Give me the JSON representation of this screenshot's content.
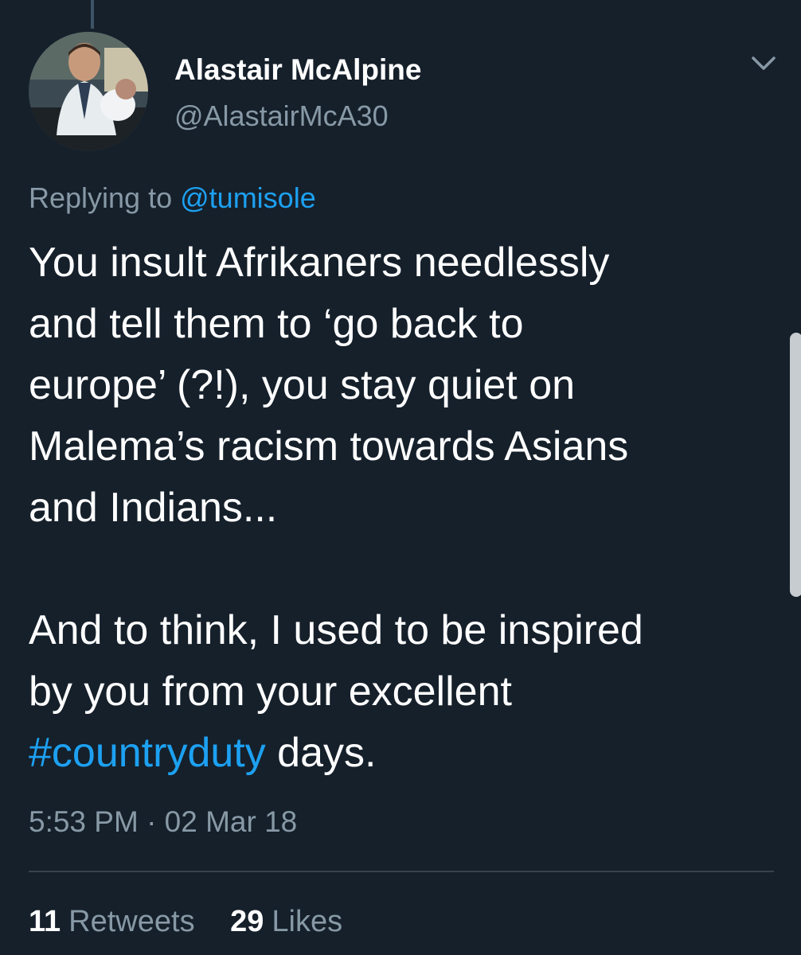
{
  "tweet": {
    "author": {
      "display_name": "Alastair McAlpine",
      "handle": "@AlastairMcA30"
    },
    "reply": {
      "prefix": "Replying to",
      "mention": "@tumisole"
    },
    "text_lines": [
      "You insult Afrikaners needlessly",
      "and tell them to ‘go back to",
      "europe’ (?!), you stay quiet on",
      "Malema’s racism towards Asians",
      "and Indians...",
      "",
      "And to think, I used to be inspired",
      "by you from your excellent"
    ],
    "last_line": {
      "hashtag": "#countryduty",
      "rest": " days."
    },
    "timestamp": "5:53 PM · 02 Mar 18",
    "stats": {
      "retweets_count": "11",
      "retweets_label": "Retweets",
      "likes_count": "29",
      "likes_label": "Likes"
    }
  },
  "icons": {
    "menu": "chevron-down-icon",
    "avatar": "avatar"
  },
  "colors": {
    "background": "#15202b",
    "text_primary": "#ffffff",
    "text_secondary": "#8899a6",
    "link": "#1da1f2",
    "divider": "#38444d"
  }
}
